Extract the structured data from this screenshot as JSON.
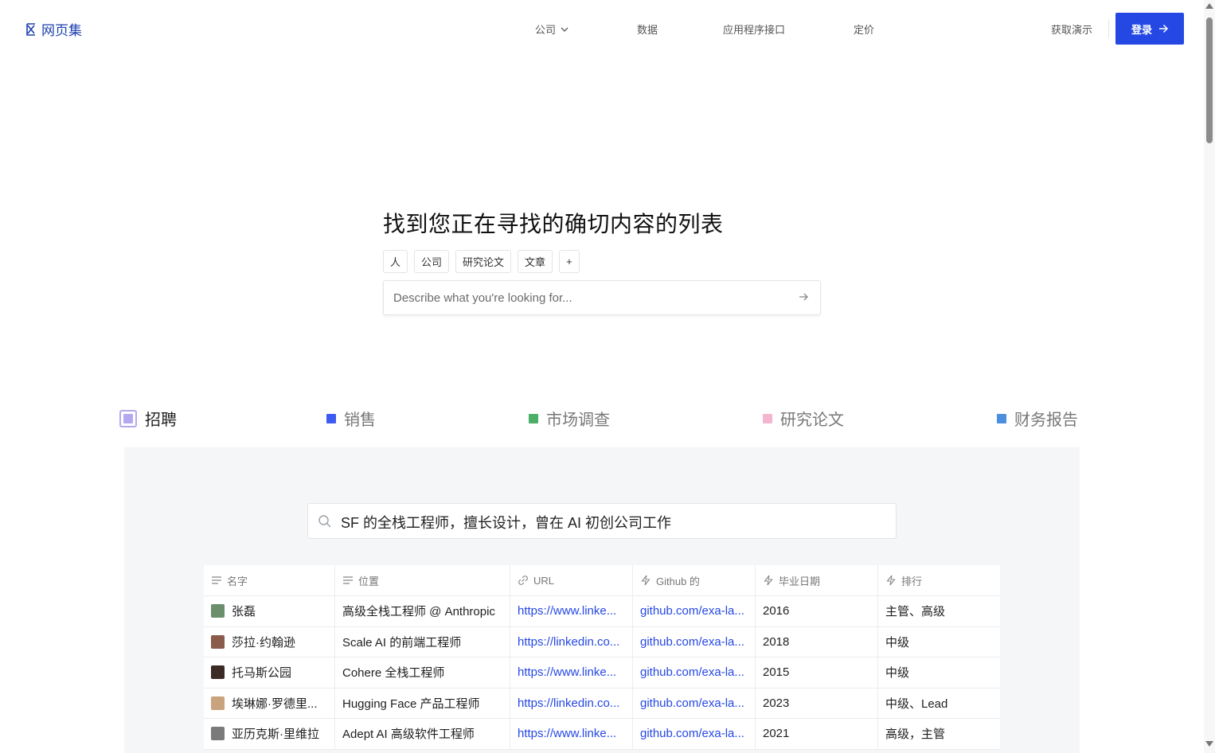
{
  "header": {
    "logo_text": "网页集",
    "nav": [
      {
        "label": "公司",
        "has_dropdown": true
      },
      {
        "label": "数据"
      },
      {
        "label": "应用程序接口"
      },
      {
        "label": "定价"
      }
    ],
    "demo_label": "获取演示",
    "login_label": "登录"
  },
  "hero": {
    "title": "找到您正在寻找的确切内容的列表",
    "chips": [
      "人",
      "公司",
      "研究论文",
      "文章",
      "+"
    ],
    "search_placeholder": "Describe what you're looking for..."
  },
  "tabs": [
    {
      "label": "招聘",
      "color": "#b4a9f0",
      "active": true
    },
    {
      "label": "销售",
      "color": "#3d5af1"
    },
    {
      "label": "市场调查",
      "color": "#4caf68"
    },
    {
      "label": "研究论文",
      "color": "#f4b6cf"
    },
    {
      "label": "财务报告",
      "color": "#4a8fe0"
    }
  ],
  "demo": {
    "query": "SF 的全栈工程师，擅长设计，曾在 AI 初创公司工作",
    "columns": [
      {
        "label": "名字",
        "icon": "text-lines-icon"
      },
      {
        "label": "位置",
        "icon": "text-lines-icon"
      },
      {
        "label": "URL",
        "icon": "link-icon"
      },
      {
        "label": "Github 的",
        "icon": "bolt-icon"
      },
      {
        "label": "毕业日期",
        "icon": "bolt-icon"
      },
      {
        "label": "排行",
        "icon": "bolt-icon"
      }
    ],
    "rows": [
      {
        "name": "张磊",
        "position": "高级全栈工程师 @ Anthropic",
        "url": "https://www.linke...",
        "github": "github.com/exa-la...",
        "grad": "2016",
        "rank": "主管、高级",
        "avatar_color": "#6b8e6b"
      },
      {
        "name": "莎拉·约翰逊",
        "position": "Scale AI 的前端工程师",
        "url": "https://linkedin.co...",
        "github": "github.com/exa-la...",
        "grad": "2018",
        "rank": "中级",
        "avatar_color": "#8a5a4a"
      },
      {
        "name": "托马斯公园",
        "position": "Cohere 全栈工程师",
        "url": "https://www.linke...",
        "github": "github.com/exa-la...",
        "grad": "2015",
        "rank": "中级",
        "avatar_color": "#3b2a25"
      },
      {
        "name": "埃琳娜·罗德里...",
        "position": "Hugging Face 产品工程师",
        "url": "https://linkedin.co...",
        "github": "github.com/exa-la...",
        "grad": "2023",
        "rank": "中级、Lead",
        "avatar_color": "#c9a27e"
      },
      {
        "name": "亚历克斯·里维拉",
        "position": "Adept AI 高级软件工程师",
        "url": "https://www.linke...",
        "github": "github.com/exa-la...",
        "grad": "2021",
        "rank": "高级，主管",
        "avatar_color": "#7a7a7a"
      }
    ]
  }
}
